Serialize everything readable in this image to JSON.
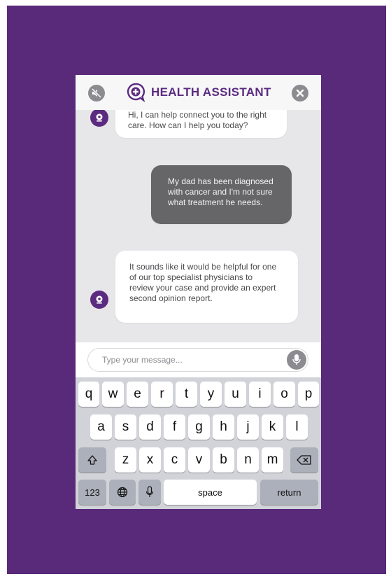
{
  "header": {
    "title": "HEALTH ASSISTANT",
    "mute_icon": "speaker-muted-icon",
    "logo_icon": "chat-plus-icon",
    "close_icon": "close-icon"
  },
  "messages": [
    {
      "sender": "assistant",
      "lines": [
        "Hi, I can help connect you to the right",
        "care. How can I help you today?"
      ]
    },
    {
      "sender": "user",
      "lines": [
        "My dad has been diagnosed",
        "with cancer and I'm not sure",
        "what treatment he needs."
      ]
    },
    {
      "sender": "assistant",
      "lines": [
        "It sounds like it would be helpful for one",
        "of our top specialist physicians to",
        "review your case and provide an expert",
        "second opinion report."
      ]
    }
  ],
  "input": {
    "placeholder": "Type your message...",
    "value": ""
  },
  "keyboard": {
    "row1": [
      "q",
      "w",
      "e",
      "r",
      "t",
      "y",
      "u",
      "i",
      "o",
      "p"
    ],
    "row2": [
      "a",
      "s",
      "d",
      "f",
      "g",
      "h",
      "j",
      "k",
      "l"
    ],
    "row3": [
      "z",
      "x",
      "c",
      "v",
      "b",
      "n",
      "m"
    ],
    "numbers_label": "123",
    "space_label": "space",
    "return_label": "return"
  },
  "colors": {
    "brand_purple": "#5b2b80",
    "background_purple": "#5a2a7a",
    "user_bubble": "#666668"
  }
}
